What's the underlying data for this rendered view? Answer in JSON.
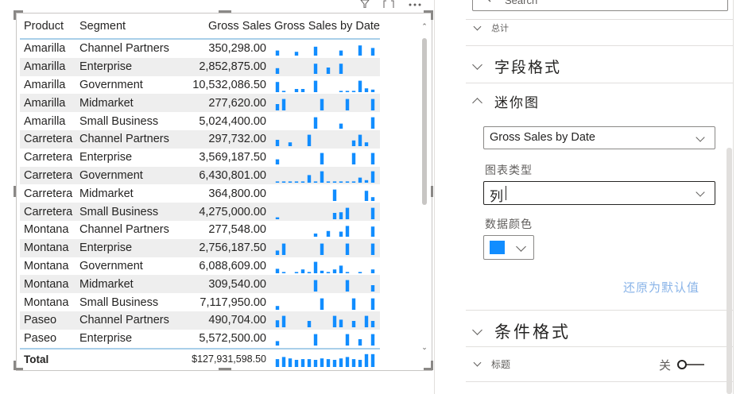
{
  "table": {
    "headers": {
      "product": "Product",
      "segment": "Segment",
      "gross_sales": "Gross Sales",
      "sparkline": "Gross Sales by Date"
    },
    "rows": [
      {
        "product": "Amarilla",
        "segment": "Channel Partners",
        "gross_sales": "350,298.00",
        "spark": [
          0.4,
          0,
          0,
          0.3,
          0,
          0,
          0.7,
          0,
          0,
          0,
          0.4,
          0,
          0,
          0.8,
          0,
          0.6
        ]
      },
      {
        "product": "Amarilla",
        "segment": "Enterprise",
        "gross_sales": "2,852,875.00",
        "spark": [
          0.45,
          0,
          0,
          0,
          0,
          0,
          0.8,
          0,
          0.5,
          0,
          0.8,
          0,
          0,
          0,
          0,
          0
        ]
      },
      {
        "product": "Amarilla",
        "segment": "Government",
        "gross_sales": "10,532,086.50",
        "spark": [
          0.8,
          0.1,
          0,
          0.25,
          0.25,
          0,
          0.9,
          0,
          0,
          0,
          0.1,
          0.1,
          0.1,
          0.9,
          0.3,
          0.2
        ]
      },
      {
        "product": "Amarilla",
        "segment": "Midmarket",
        "gross_sales": "277,620.00",
        "spark": [
          0.5,
          0.9,
          0,
          0,
          0,
          0,
          0,
          0.9,
          0,
          0,
          0,
          0.9,
          0,
          0,
          0,
          0.9
        ]
      },
      {
        "product": "Amarilla",
        "segment": "Small Business",
        "gross_sales": "5,024,400.00",
        "spark": [
          0,
          0,
          0,
          0,
          0,
          0,
          0.9,
          0,
          0,
          0,
          0.4,
          0,
          0,
          0,
          0,
          0.9
        ]
      },
      {
        "product": "Carretera",
        "segment": "Channel Partners",
        "gross_sales": "297,732.00",
        "spark": [
          0.5,
          0,
          0.3,
          0,
          0,
          0.9,
          0,
          0,
          0,
          0,
          0,
          0,
          0.45,
          0.9,
          0.3,
          0
        ]
      },
      {
        "product": "Carretera",
        "segment": "Enterprise",
        "gross_sales": "3,569,187.50",
        "spark": [
          0.4,
          0,
          0,
          0,
          0,
          0,
          0,
          0.9,
          0,
          0,
          0,
          0,
          0.9,
          0,
          0,
          0.9
        ]
      },
      {
        "product": "Carretera",
        "segment": "Government",
        "gross_sales": "6,430,801.00",
        "spark": [
          0.1,
          0.1,
          0.1,
          0.1,
          0.1,
          0.6,
          0.1,
          0.9,
          0.1,
          0.1,
          0.1,
          0.1,
          0.1,
          0.4,
          0.2,
          0.9
        ]
      },
      {
        "product": "Carretera",
        "segment": "Midmarket",
        "gross_sales": "364,800.00",
        "spark": [
          0,
          0,
          0,
          0,
          0,
          0,
          0,
          0,
          0,
          0.9,
          0,
          0,
          0,
          0,
          0.8,
          0.3
        ]
      },
      {
        "product": "Carretera",
        "segment": "Small Business",
        "gross_sales": "4,275,000.00",
        "spark": [
          0.15,
          0,
          0,
          0,
          0,
          0,
          0,
          0,
          0,
          0.5,
          0.55,
          0.9,
          0,
          0,
          0,
          0.9
        ]
      },
      {
        "product": "Montana",
        "segment": "Channel Partners",
        "gross_sales": "277,548.00",
        "spark": [
          0,
          0,
          0,
          0,
          0,
          0,
          0.25,
          0,
          0.45,
          0,
          0.4,
          0.85,
          0,
          0,
          0,
          0.8
        ]
      },
      {
        "product": "Montana",
        "segment": "Enterprise",
        "gross_sales": "2,756,187.50",
        "spark": [
          0.35,
          0.9,
          0,
          0,
          0,
          0,
          0,
          0.9,
          0,
          0,
          0,
          0.9,
          0,
          0,
          0,
          0.9
        ]
      },
      {
        "product": "Montana",
        "segment": "Government",
        "gross_sales": "6,088,609.00",
        "spark": [
          0.35,
          0.1,
          0,
          0.1,
          0.3,
          0.1,
          0.9,
          0.2,
          0.1,
          0.3,
          0.6,
          0.1,
          0,
          0.1,
          0,
          0.3
        ]
      },
      {
        "product": "Montana",
        "segment": "Midmarket",
        "gross_sales": "309,540.00",
        "spark": [
          0,
          0,
          0,
          0,
          0,
          0,
          0.9,
          0,
          0,
          0,
          0,
          0.9,
          0,
          0,
          0,
          0.5
        ]
      },
      {
        "product": "Montana",
        "segment": "Small Business",
        "gross_sales": "7,117,950.00",
        "spark": [
          0.3,
          0,
          0,
          0,
          0,
          0,
          0,
          0.9,
          0,
          0,
          0,
          0,
          0.9,
          0,
          0,
          0.9
        ]
      },
      {
        "product": "Paseo",
        "segment": "Channel Partners",
        "gross_sales": "490,704.00",
        "spark": [
          0.55,
          0.9,
          0,
          0,
          0,
          0.5,
          0,
          0,
          0,
          0.9,
          0.6,
          0,
          0.5,
          0,
          0.9,
          0.5
        ]
      },
      {
        "product": "Paseo",
        "segment": "Enterprise",
        "gross_sales": "5,572,500.00",
        "spark": [
          0.35,
          0,
          0,
          0,
          0,
          0,
          0.9,
          0,
          0,
          0,
          0,
          0.9,
          0,
          0.5,
          0,
          0.9
        ]
      }
    ],
    "total": {
      "label": "Total",
      "gross_sales": "$127,931,598.50",
      "spark": [
        0.55,
        0.7,
        0.6,
        0.5,
        0.55,
        0.55,
        0.5,
        0.6,
        0.55,
        0.5,
        0.6,
        0.7,
        0.55,
        0.5,
        0.9,
        0.9
      ]
    }
  },
  "pane": {
    "search_placeholder": "Search",
    "subtotal_label": "总计",
    "field_format": "字段格式",
    "sparkline_section": "迷你图",
    "sparkline_select": "Gross Sales by Date",
    "chart_type_label": "图表类型",
    "chart_type_value": "列",
    "data_color_label": "数据颜色",
    "data_color": "#118dff",
    "reset_label": "还原为默认值",
    "conditional_format": "条件格式",
    "title_label": "标题",
    "toggle_state": "关"
  },
  "colors": {
    "spark": "#118dff",
    "accent": "#118dff"
  }
}
